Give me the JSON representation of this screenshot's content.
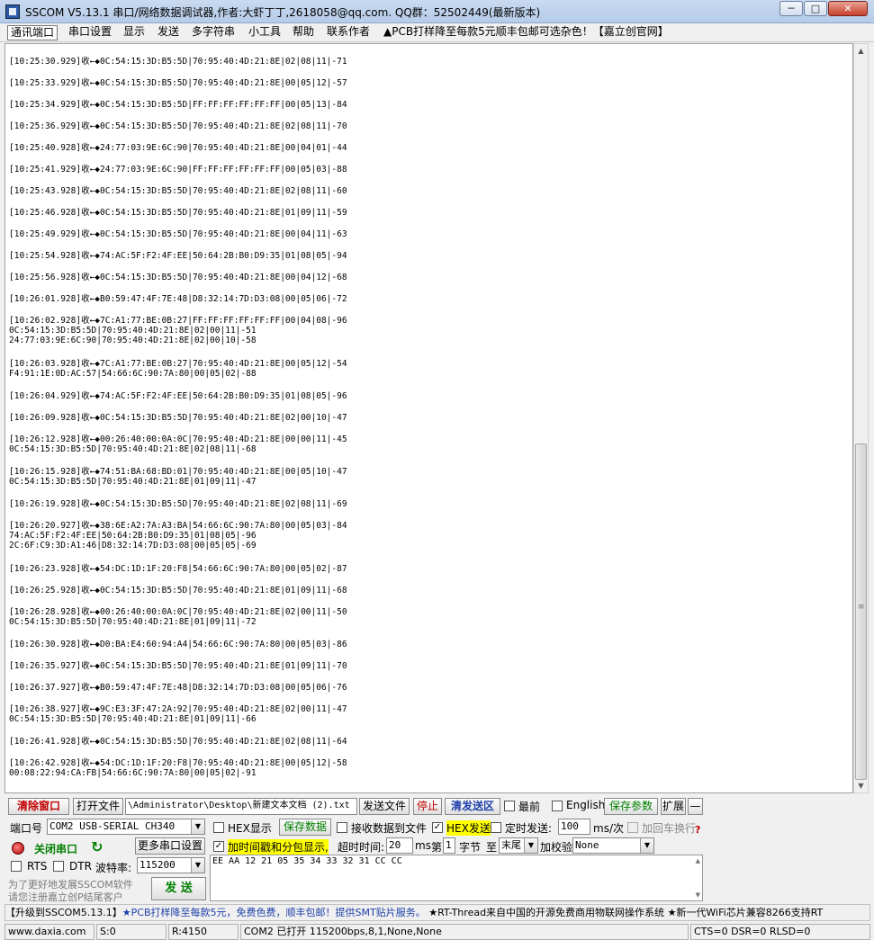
{
  "window": {
    "title": "SSCOM V5.13.1 串口/网络数据调试器,作者:大虾丁丁,2618058@qq.com. QQ群：52502449(最新版本)",
    "minimize": "─",
    "maximize": "□",
    "close": "✕"
  },
  "menu": [
    "通讯端口",
    "串口设置",
    "显示",
    "发送",
    "多字符串",
    "小工具",
    "帮助",
    "联系作者",
    "▲PCB打样降至每款5元顺丰包邮可选杂色！【嘉立创官网】"
  ],
  "log_lines": [
    "[10:25:30.929]收←◆0C:54:15:3D:B5:5D|70:95:40:4D:21:8E|02|08|11|-71",
    "[10:25:33.929]收←◆0C:54:15:3D:B5:5D|70:95:40:4D:21:8E|00|05|12|-57",
    "[10:25:34.929]收←◆0C:54:15:3D:B5:5D|FF:FF:FF:FF:FF:FF|00|05|13|-84",
    "[10:25:36.929]收←◆0C:54:15:3D:B5:5D|70:95:40:4D:21:8E|02|08|11|-70",
    "[10:25:40.928]收←◆24:77:03:9E:6C:90|70:95:40:4D:21:8E|00|04|01|-44",
    "[10:25:41.929]收←◆24:77:03:9E:6C:90|FF:FF:FF:FF:FF:FF|00|05|03|-88",
    "[10:25:43.928]收←◆0C:54:15:3D:B5:5D|70:95:40:4D:21:8E|02|08|11|-60",
    "[10:25:46.928]收←◆0C:54:15:3D:B5:5D|70:95:40:4D:21:8E|01|09|11|-59",
    "[10:25:49.929]收←◆0C:54:15:3D:B5:5D|70:95:40:4D:21:8E|00|04|11|-63",
    "[10:25:54.928]收←◆74:AC:5F:F2:4F:EE|50:64:2B:B0:D9:35|01|08|05|-94",
    "[10:25:56.928]收←◆0C:54:15:3D:B5:5D|70:95:40:4D:21:8E|00|04|12|-68",
    "[10:26:01.928]收←◆B0:59:47:4F:7E:48|D8:32:14:7D:D3:08|00|05|06|-72",
    "[10:26:02.928]收←◆7C:A1:77:BE:0B:27|FF:FF:FF:FF:FF:FF|00|04|08|-96",
    "0C:54:15:3D:B5:5D|70:95:40:4D:21:8E|02|00|11|-51",
    "24:77:03:9E:6C:90|70:95:40:4D:21:8E|02|00|10|-58",
    "[10:26:03.928]收←◆7C:A1:77:BE:0B:27|70:95:40:4D:21:8E|00|05|12|-54",
    "F4:91:1E:0D:AC:57|54:66:6C:90:7A:80|00|05|02|-88",
    "[10:26:04.929]收←◆74:AC:5F:F2:4F:EE|50:64:2B:B0:D9:35|01|08|05|-96",
    "[10:26:09.928]收←◆0C:54:15:3D:B5:5D|70:95:40:4D:21:8E|02|00|10|-47",
    "[10:26:12.928]收←◆00:26:40:00:0A:0C|70:95:40:4D:21:8E|00|00|11|-45",
    "0C:54:15:3D:B5:5D|70:95:40:4D:21:8E|02|08|11|-68",
    "[10:26:15.928]收←◆74:51:BA:68:BD:01|70:95:40:4D:21:8E|00|05|10|-47",
    "0C:54:15:3D:B5:5D|70:95:40:4D:21:8E|01|09|11|-47",
    "[10:26:19.928]收←◆0C:54:15:3D:B5:5D|70:95:40:4D:21:8E|02|08|11|-69",
    "[10:26:20.927]收←◆38:6E:A2:7A:A3:BA|54:66:6C:90:7A:80|00|05|03|-84",
    "74:AC:5F:F2:4F:EE|50:64:2B:B0:D9:35|01|08|05|-96",
    "2C:6F:C9:3D:A1:46|D8:32:14:7D:D3:08|00|05|05|-69",
    "[10:26:23.928]收←◆54:DC:1D:1F:20:F8|54:66:6C:90:7A:80|00|05|02|-87",
    "[10:26:25.928]收←◆0C:54:15:3D:B5:5D|70:95:40:4D:21:8E|01|09|11|-68",
    "[10:26:28.928]收←◆00:26:40:00:0A:0C|70:95:40:4D:21:8E|02|00|11|-50",
    "0C:54:15:3D:B5:5D|70:95:40:4D:21:8E|01|09|11|-72",
    "[10:26:30.928]收←◆D0:BA:E4:60:94:A4|54:66:6C:90:7A:80|00|05|03|-86",
    "[10:26:35.927]收←◆0C:54:15:3D:B5:5D|70:95:40:4D:21:8E|01|09|11|-70",
    "[10:26:37.927]收←◆B0:59:47:4F:7E:48|D8:32:14:7D:D3:08|00|05|06|-76",
    "[10:26:38.927]收←◆9C:E3:3F:47:2A:92|70:95:40:4D:21:8E|02|00|11|-47",
    "0C:54:15:3D:B5:5D|70:95:40:4D:21:8E|01|09|11|-66",
    "[10:26:41.928]收←◆0C:54:15:3D:B5:5D|70:95:40:4D:21:8E|02|08|11|-64",
    "[10:26:42.928]收←◆54:DC:1D:1F:20:F8|70:95:40:4D:21:8E|00|05|12|-58",
    "00:08:22:94:CA:FB|54:66:6C:90:7A:80|00|05|02|-91"
  ],
  "toolbar": {
    "clear_window": "清除窗口",
    "open_file": "打开文件",
    "file_path": "\\Administrator\\Desktop\\新建文本文档 (2).txt",
    "send_file": "发送文件",
    "stop": "停止",
    "clear_send": "清发送区",
    "topmost": "最前",
    "english": "English",
    "save_params": "保存参数",
    "expand": "扩展",
    "collapse": "—"
  },
  "port": {
    "port_label": "端口号",
    "port_value": "COM2 USB-SERIAL CH340",
    "close_port": "关闭串口",
    "more_settings": "更多串口设置",
    "rts": "RTS",
    "dtr": "DTR",
    "baud_label": "波特率:",
    "baud_value": "115200",
    "promo_line1": "为了更好地发展SSCOM软件",
    "promo_line2": "请您注册嘉立创P结尾客户"
  },
  "options": {
    "hex_display": "HEX显示",
    "save_data": "保存数据",
    "recv_to_file": "接收数据到文件",
    "hex_send": "HEX发送",
    "timed_send": "定时发送:",
    "interval": "100",
    "interval_unit": "ms/次",
    "append_crlf": "加回车换行",
    "timestamp": "加时间戳和分包显示,",
    "timeout_label": "超时时间:",
    "timeout_value": "20",
    "timeout_unit": "ms",
    "nth_label": "第",
    "nth_value": "1",
    "byte_label": "字节",
    "to_label": "至",
    "to_value": "末尾",
    "checksum_label": "加校验",
    "checksum_value": "None"
  },
  "send": {
    "content": "EE AA 12 21 05 35 34 33 32 31 CC CC",
    "send_button": "发 送"
  },
  "ticker": {
    "prefix": "【升级到SSCOM5.13.1】",
    "link1": "★PCB打样降至每款5元，免费色费，顺丰包邮！提供SMT贴片服务。",
    "text2": "★RT-Thread来自中国的开源免费商用物联网操作系统",
    "text3": "★新一代WiFi芯片兼容8266支持RT"
  },
  "statusbar": {
    "site": "www.daxia.com",
    "sent": "S:0",
    "received": "R:4150",
    "port_status": "COM2 已打开  115200bps,8,1,None,None",
    "lines": "CTS=0 DSR=0 RLSD=0"
  }
}
